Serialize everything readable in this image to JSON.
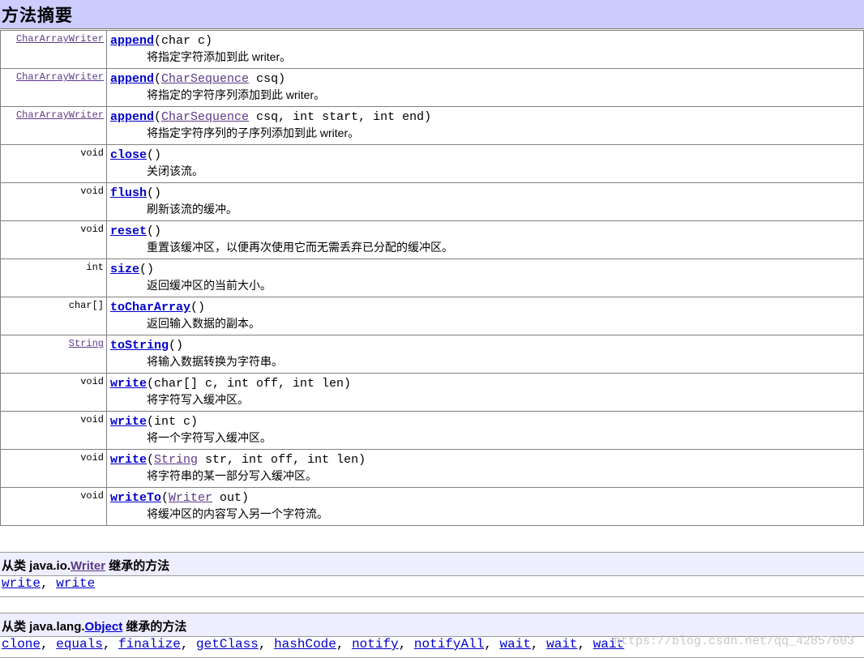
{
  "title": "方法摘要",
  "methods": [
    {
      "rtype": "CharArrayWriter",
      "rlink": true,
      "name": "append",
      "params": [
        {
          "t": "(char c)"
        }
      ],
      "desc": "将指定字符添加到此 writer。"
    },
    {
      "rtype": "CharArrayWriter",
      "rlink": true,
      "name": "append",
      "params": [
        {
          "t": "("
        },
        {
          "l": "CharSequence"
        },
        {
          "t": " csq)"
        }
      ],
      "desc": "将指定的字符序列添加到此 writer。"
    },
    {
      "rtype": "CharArrayWriter",
      "rlink": true,
      "name": "append",
      "params": [
        {
          "t": "("
        },
        {
          "l": "CharSequence"
        },
        {
          "t": " csq, int start, int end)"
        }
      ],
      "desc": "将指定字符序列的子序列添加到此 writer。"
    },
    {
      "rtype": "void",
      "rlink": false,
      "name": "close",
      "params": [
        {
          "t": "()"
        }
      ],
      "desc": "关闭该流。"
    },
    {
      "rtype": "void",
      "rlink": false,
      "name": "flush",
      "params": [
        {
          "t": "()"
        }
      ],
      "desc": "刷新该流的缓冲。"
    },
    {
      "rtype": "void",
      "rlink": false,
      "name": "reset",
      "params": [
        {
          "t": "()"
        }
      ],
      "desc": "重置该缓冲区，以便再次使用它而无需丢弃已分配的缓冲区。"
    },
    {
      "rtype": "int",
      "rlink": false,
      "name": "size",
      "params": [
        {
          "t": "()"
        }
      ],
      "desc": "返回缓冲区的当前大小。"
    },
    {
      "rtype": "char[]",
      "rlink": false,
      "name": "toCharArray",
      "params": [
        {
          "t": "()"
        }
      ],
      "desc": "返回输入数据的副本。"
    },
    {
      "rtype": "String",
      "rlink": true,
      "name": "toString",
      "params": [
        {
          "t": "()"
        }
      ],
      "desc": "将输入数据转换为字符串。"
    },
    {
      "rtype": "void",
      "rlink": false,
      "name": "write",
      "params": [
        {
          "t": "(char[] c, int off, int len)"
        }
      ],
      "desc": "将字符写入缓冲区。"
    },
    {
      "rtype": "void",
      "rlink": false,
      "name": "write",
      "params": [
        {
          "t": "(int c)"
        }
      ],
      "desc": "将一个字符写入缓冲区。"
    },
    {
      "rtype": "void",
      "rlink": false,
      "name": "write",
      "params": [
        {
          "t": "("
        },
        {
          "l": "String"
        },
        {
          "t": " str, int off, int len)"
        }
      ],
      "desc": "将字符串的某一部分写入缓冲区。"
    },
    {
      "rtype": "void",
      "rlink": false,
      "name": "writeTo",
      "params": [
        {
          "t": "("
        },
        {
          "l": "Writer"
        },
        {
          "t": " out)"
        }
      ],
      "desc": "将缓冲区的内容写入另一个字符流。"
    }
  ],
  "inherited_writer": {
    "prefix": "从类 java.io.",
    "class_link": "Writer",
    "suffix": " 继承的方法",
    "methods": [
      "write",
      "write"
    ]
  },
  "inherited_object": {
    "prefix": "从类 java.lang.",
    "class_link": "Object",
    "suffix": " 继承的方法",
    "methods": [
      "clone",
      "equals",
      "finalize",
      "getClass",
      "hashCode",
      "notify",
      "notifyAll",
      "wait",
      "wait",
      "wait"
    ]
  },
  "watermark": "https://blog.csdn.net/qq_42857603"
}
